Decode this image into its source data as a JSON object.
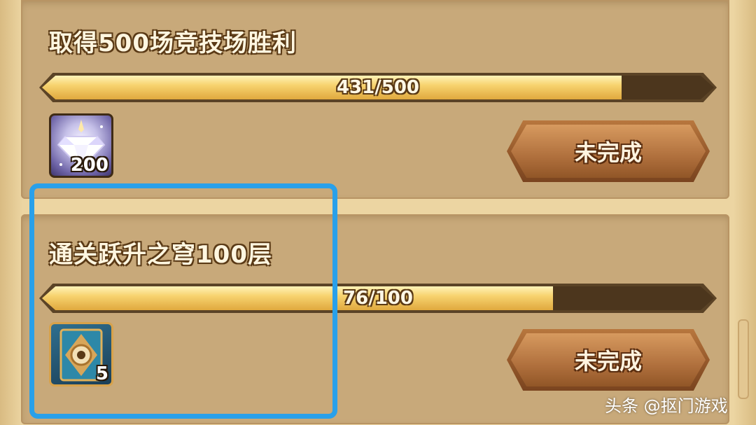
{
  "quests": [
    {
      "title": "取得500场竞技场胜利",
      "progress_text": "431/500",
      "progress_fraction": 0.862,
      "reward_icon": "diamond-icon",
      "reward_count": "200",
      "status_button": "未完成"
    },
    {
      "title": "通关跃升之穹100层",
      "progress_text": "76/100",
      "progress_fraction": 0.76,
      "reward_icon": "tarot-card-icon",
      "reward_count": "5",
      "status_button": "未完成"
    }
  ],
  "highlight_color": "#29a0ea",
  "watermark": "头条 @抠门游戏"
}
